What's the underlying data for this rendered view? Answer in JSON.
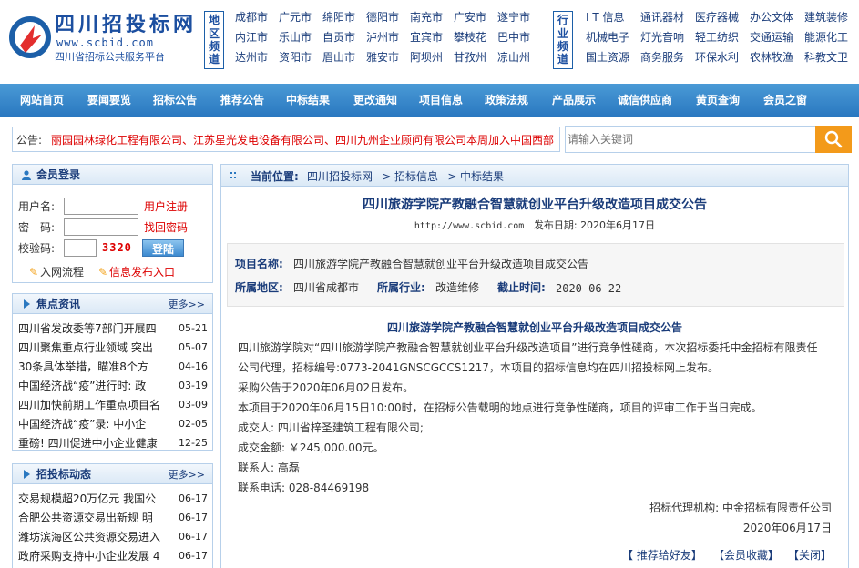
{
  "header": {
    "logo_title": "四川招投标网",
    "logo_url": "www.scbid.com",
    "logo_sub": "四川省招标公共服务平台",
    "region_label": "地区频道",
    "regions": [
      "成都市",
      "广元市",
      "绵阳市",
      "德阳市",
      "南充市",
      "广安市",
      "遂宁市",
      "内江市",
      "乐山市",
      "自贡市",
      "泸州市",
      "宜宾市",
      "攀枝花",
      "巴中市",
      "达州市",
      "资阳市",
      "眉山市",
      "雅安市",
      "阿坝州",
      "甘孜州",
      "凉山州"
    ],
    "industry_label": "行业频道",
    "industries": [
      "I T 信息",
      "通讯器材",
      "医疗器械",
      "办公文体",
      "建筑装修",
      "机械电子",
      "灯光音响",
      "轻工纺织",
      "交通运输",
      "能源化工",
      "国土资源",
      "商务服务",
      "环保水利",
      "农林牧渔",
      "科教文卫"
    ]
  },
  "nav": [
    "网站首页",
    "要闻要览",
    "招标公告",
    "推荐公告",
    "中标结果",
    "更改通知",
    "项目信息",
    "政策法规",
    "产品展示",
    "诚信供应商",
    "黄页查询",
    "会员之窗"
  ],
  "notice": {
    "label": "公告:",
    "text": "丽园园林绿化工程有限公司、江苏星光发电设备有限公司、四川九州企业顾问有限公司本周加入中国西部"
  },
  "search": {
    "placeholder": "请输入关键词"
  },
  "login": {
    "title": "会员登录",
    "username_label": "用户名:",
    "password_label": "密　码:",
    "captcha_label": "校验码:",
    "register_link": "用户注册",
    "recover_link": "找回密码",
    "captcha_value": "3320",
    "login_button": "登陆",
    "flow_link": "入网流程",
    "post_link": "信息发布入口"
  },
  "focus": {
    "title": "焦点资讯",
    "more": "更多>>",
    "items": [
      {
        "t": "四川省发改委等7部门开展四",
        "d": "05-21"
      },
      {
        "t": "四川聚焦重点行业领域 突出",
        "d": "05-07"
      },
      {
        "t": "30条具体举措，瞄准8个方",
        "d": "04-16"
      },
      {
        "t": "中国经济战“疫”进行时: 政",
        "d": "03-19"
      },
      {
        "t": "四川加快前期工作重点项目名",
        "d": "03-09"
      },
      {
        "t": "中国经济战“疫”录: 中小企",
        "d": "02-05"
      },
      {
        "t": "重磅! 四川促进中小企业健康",
        "d": "12-25"
      }
    ]
  },
  "bidnews": {
    "title": "招投标动态",
    "more": "更多>>",
    "items": [
      {
        "t": "交易规模超20万亿元 我国公",
        "d": "06-17"
      },
      {
        "t": "合肥公共资源交易出新规 明",
        "d": "06-17"
      },
      {
        "t": "潍坊滨海区公共资源交易进入",
        "d": "06-17"
      },
      {
        "t": "政府采购支持中小企业发展 4",
        "d": "06-17"
      }
    ]
  },
  "breadcrumb": {
    "label": "当前位置:",
    "site": "四川招投标网",
    "sep": "->",
    "section": "招标信息",
    "current": "中标结果"
  },
  "article": {
    "title": "四川旅游学院产教融合智慧就创业平台升级改造项目成交公告",
    "url": "http://www.scbid.com",
    "date_label": "发布日期:",
    "date": "2020年6月17日",
    "project_label": "项目名称:",
    "project": "四川旅游学院产教融合智慧就创业平台升级改造项目成交公告",
    "region_label": "所属地区:",
    "region": "四川省成都市",
    "industry_label": "所属行业:",
    "industry": "改造维修",
    "deadline_label": "截止时间:",
    "deadline": "2020-06-22",
    "body_title": "四川旅游学院产教融合智慧就创业平台升级改造项目成交公告",
    "p1a": "四川旅游学院对“四川旅游学院产教融合智慧就创业平台升级改造项目”进行竞争性磋商，本次招标委托中金招标有限责任",
    "p1b": "公司代理，招标编号:0773-2041GNSCGCCS1217，本项目的招标信息均在四川招投标网上发布。",
    "p2": "采购公告于2020年06月02日发布。",
    "p3": "本项目于2020年06月15日10:00时，在招标公告载明的地点进行竞争性磋商，项目的评审工作于当日完成。",
    "p4": "成交人: 四川省梓圣建筑工程有限公司;",
    "p5": "成交金额: ￥245,000.00元。",
    "p6": "联系人: 高磊",
    "p7": "联系电话: 028-84469198",
    "agency": "招标代理机构: 中金招标有限责任公司",
    "sign_date": "2020年06月17日",
    "action_recommend": "【 推荐给好友】",
    "action_favorite": "【会员收藏】",
    "action_close": "【关闭】"
  }
}
